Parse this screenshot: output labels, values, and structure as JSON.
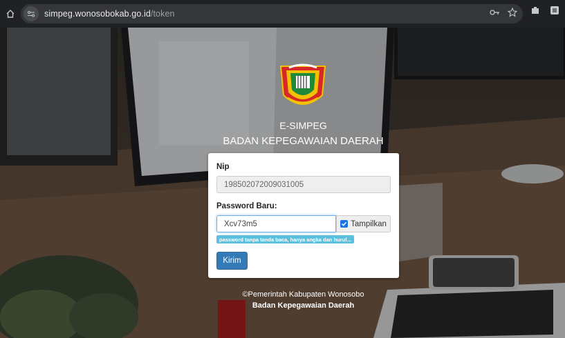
{
  "browser": {
    "url_host": "simpeg.wonosobokab.go.id",
    "url_path": "/token",
    "icons": [
      "home-icon",
      "site-settings-icon",
      "password-key-icon",
      "bookmark-star-icon",
      "extensions-icon",
      "profile-icon"
    ]
  },
  "header": {
    "app_name": "E-SIMPEG",
    "org_name": "BADAN KEPEGAWAIAN DAERAH"
  },
  "form": {
    "nip_label": "Nip",
    "nip_value": "198502072009031005",
    "password_label": "Password Baru:",
    "password_value": "Xcv73m5",
    "show_label": "Tampilkan",
    "show_checked": true,
    "hint": "password tanpa tanda baca, hanya angka dan huruf...",
    "submit_label": "Kirim"
  },
  "footer": {
    "copyright": "©Pemerintah Kabupaten Wonosobo",
    "org": "Badan Kepegawaian Daerah"
  },
  "colors": {
    "primary_button": "#337ab7",
    "hint_badge": "#5bc0de",
    "checkbox": "#1a73e8"
  }
}
